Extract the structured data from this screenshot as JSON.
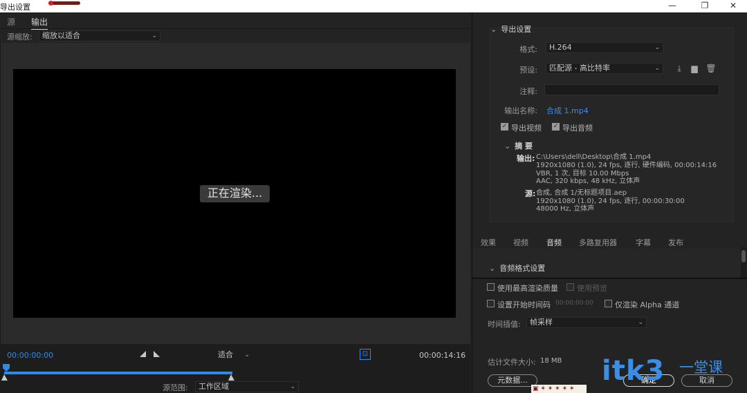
{
  "window": {
    "title": "导出设置",
    "minimize": "—",
    "maximize": "❐",
    "close": "✕"
  },
  "left": {
    "tabs": [
      {
        "label": "源"
      },
      {
        "label": "输出"
      }
    ],
    "source_scale_label": "源缩放:",
    "source_scale_value": "缩放以适合",
    "rendering_text": "正在渲染...",
    "timecode_start": "00:00:00:00",
    "timecode_end": "00:00:14:16",
    "zoom_value": "适合",
    "source_range_label": "源范围:",
    "source_range_value": "工作区域"
  },
  "export_settings": {
    "section_title": "导出设置",
    "format_label": "格式:",
    "format_value": "H.264",
    "preset_label": "预设:",
    "preset_value": "匹配源 - 高比特率",
    "comment_label": "注释:",
    "comment_value": "",
    "output_name_label": "输出名称:",
    "output_name_value": "合成 1.mp4",
    "export_video_label": "导出视频",
    "export_audio_label": "导出音频",
    "summary_title": "摘 要",
    "output_key": "输出:",
    "output_lines": [
      "C:\\Users\\dell\\Desktop\\合成 1.mp4",
      "1920x1080 (1.0), 24 fps, 逐行, 硬件编码, 00:00:14:16",
      "VBR, 1 次, 目标 10.00 Mbps",
      "AAC, 320 kbps, 48 kHz, 立体声"
    ],
    "source_key": "源:",
    "source_lines": [
      "合成, 合成 1/无标题项目.aep",
      "1920x1080 (1.0), 24 fps, 逐行, 00:00:30:00",
      "48000 Hz, 立体声"
    ]
  },
  "right_tabs": [
    {
      "label": "效果"
    },
    {
      "label": "视频"
    },
    {
      "label": "音频"
    },
    {
      "label": "多路复用器"
    },
    {
      "label": "字幕"
    },
    {
      "label": "发布"
    }
  ],
  "audio_section_title": "音频格式设置",
  "options": {
    "max_quality_label": "使用最高渲染质量",
    "use_preview_label": "使用预览",
    "set_start_tc_label": "设置开始时间码",
    "start_tc_value": "00:00:00:00",
    "alpha_only_label": "仅渲染 Alpha 通道",
    "interp_label": "时间插值:",
    "interp_value": "帧采样",
    "est_size_label": "估计文件大小:",
    "est_size_value": "18 MB"
  },
  "buttons": {
    "metadata": "元数据...",
    "ok": "确定",
    "cancel": "取消"
  },
  "watermark": {
    "text": "itk3",
    "cn": "一堂课"
  },
  "colors": {
    "accent_blue": "#2d8ceb",
    "panel_bg": "#232323",
    "preview_bg": "#000000"
  }
}
